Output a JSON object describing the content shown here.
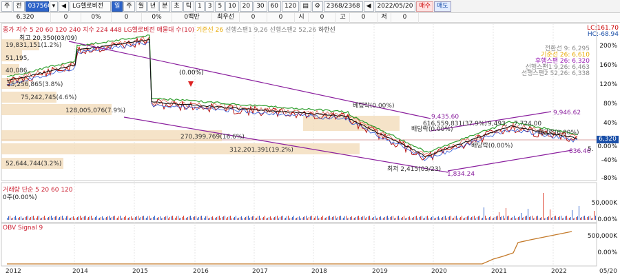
{
  "toolbar": {
    "market": "주",
    "mode": "전",
    "code": "037560",
    "name": "LG헬로비전",
    "period_tabs": [
      "일",
      "주",
      "월",
      "년",
      "분",
      "초",
      "틱"
    ],
    "intervals": [
      "1",
      "3",
      "5",
      "10",
      "20",
      "30",
      "60",
      "120"
    ],
    "count": "2368",
    "total": "/2368",
    "date": "2022/05/20",
    "buy": "매수",
    "sell": "매도"
  },
  "info_row": {
    "price": "6,320",
    "c1": "0",
    "c2": "0%",
    "c3": "0",
    "c4": "0%",
    "c5": "0백만",
    "c6": "최우선",
    "c7": "0",
    "c8": "0",
    "c9": "시",
    "c10": "0",
    "c11": "고",
    "c12": "0",
    "c13": "저",
    "c14": "0"
  },
  "price_panel": {
    "legend": "종가 지수 5 20 60 120 240 지수 224 448 LG헬로비전 매물대 수(10)",
    "legend_extra": [
      "기준선 26",
      "선행스팬1 9,26",
      "선행스팬2 52,26",
      "하한선"
    ],
    "high_label": "최고 20,350(03/09)",
    "right_top": [
      "LC:161.70",
      "HC:-68.94"
    ],
    "right_legend": [
      "전환선 9: 6,295",
      "기준선 26: 6,610",
      "후행스팬 26: 6,320",
      "선행스팬1 9,26: 6,463",
      "선행스팬2 52,26: 6,338"
    ],
    "pct_ticks": [
      "200%",
      "160%",
      "120%",
      "80%",
      "40%",
      "0.00%",
      "-40%",
      "-80%"
    ],
    "price_tag": "6,320",
    "price_tag_pct": "0.00%",
    "volume_profile": [
      "19,831,151(1.2%)",
      "51,195,",
      "40,086,",
      "25,256,865(3.8%)",
      "75,242,745(4.6%)",
      "128,005,076(7.9%)",
      "270,399,769(16.6%)",
      "312,201,391(19.2%)",
      "52,644,744(3.2%)",
      "616,559,831(37.9%)",
      "9,493,",
      "7,724,00"
    ],
    "annotations": [
      "(0.00%)",
      "9,435.60",
      "9,946.62",
      "최저 2,415(03/23)",
      "1,834.24",
      "836.46",
      "5."
    ],
    "divergence": [
      "베팅락(0.00%)",
      "배당락(0.00%)",
      "배당락(0.00%)",
      "배당락(0.00%)"
    ]
  },
  "volume_panel": {
    "legend": "거래량 단순 5 20 60 120",
    "sub": "0주(0.00%)",
    "ticks": [
      "50,000K",
      "0.00%"
    ]
  },
  "obv_panel": {
    "legend": "OBV Signal 9",
    "ticks": [
      "500,000K",
      "0.00%"
    ]
  },
  "x_axis": [
    "2012",
    "2014",
    "2015",
    "2016",
    "2017",
    "2018",
    "2019",
    "2020",
    "2021",
    "2022",
    "05/20"
  ],
  "colors": {
    "price": "#b00000",
    "ma5": "#e04b3a",
    "ma20": "#2b58d9",
    "ma60": "#2e9e2e",
    "ma120": "#111111",
    "cloud": "#f2d9b5",
    "channel": "#8a1f9e",
    "obv": "#c47a2a"
  }
}
